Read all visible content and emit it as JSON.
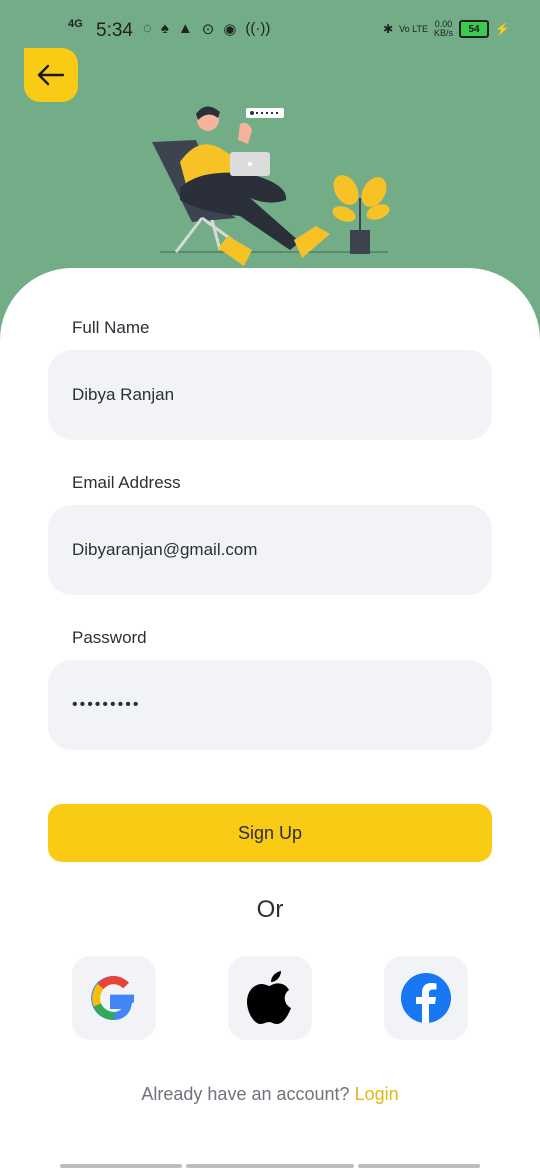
{
  "status_bar": {
    "network": "4G",
    "time": "5:34",
    "volte": "Vo LTE",
    "speed_value": "0.00",
    "speed_unit": "KB/s",
    "battery": "54"
  },
  "header": {
    "back_icon": "arrow-left-icon"
  },
  "form": {
    "full_name_label": "Full Name",
    "full_name_value": "Dibya Ranjan",
    "email_label": "Email Address",
    "email_value": "Dibyaranjan@gmail.com",
    "password_label": "Password",
    "password_value": "•••••••••"
  },
  "signup_label": "Sign Up",
  "or_label": "Or",
  "social": {
    "google_icon": "google-icon",
    "apple_icon": "apple-icon",
    "facebook_icon": "facebook-icon"
  },
  "footer": {
    "prompt": "Already have an account?",
    "login_link": "Login"
  },
  "colors": {
    "header_bg": "#72ad88",
    "accent": "#f9cb15",
    "field_bg": "#f2f3f6",
    "text": "#2b2f38"
  }
}
